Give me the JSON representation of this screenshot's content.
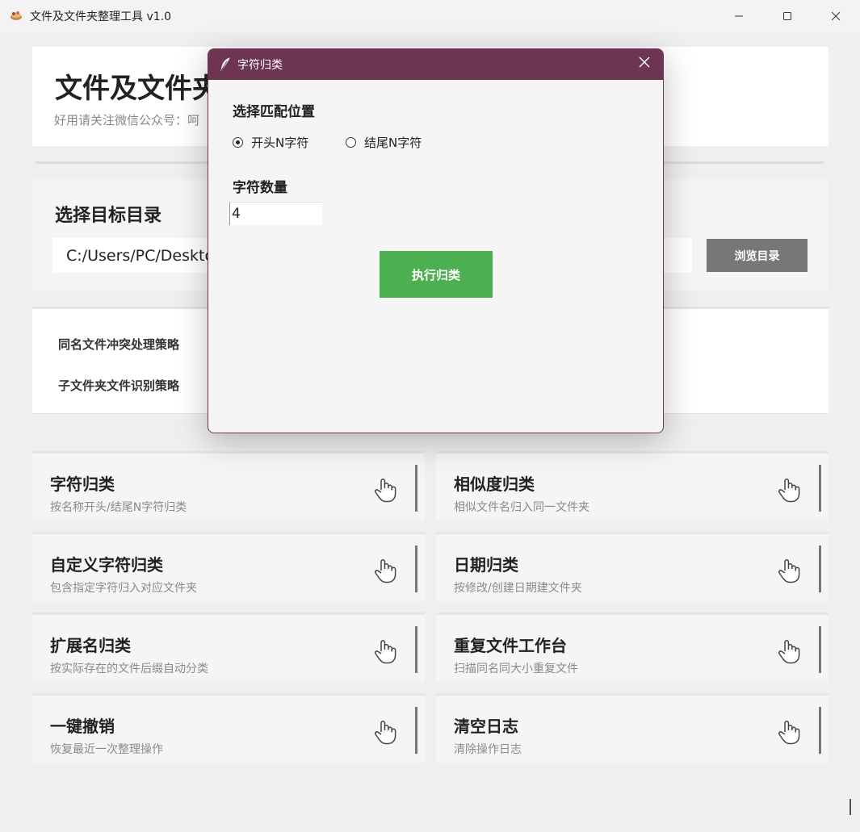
{
  "window": {
    "title": "文件及文件夹整理工具 v1.0",
    "minimize_icon": "minimize-icon",
    "maximize_icon": "maximize-icon",
    "close_icon": "close-icon"
  },
  "header": {
    "title": "文件及文件夹",
    "subtitle": "好用请关注微信公众号：呵"
  },
  "target_dir": {
    "heading": "选择目标目录",
    "path_value": "C:/Users/PC/Deskto",
    "browse_label": "浏览目录"
  },
  "strategies": {
    "conflict_label": "同名文件冲突处理策略",
    "subfolder_label": "子文件夹文件识别策略"
  },
  "features": [
    {
      "title": "字符归类",
      "desc": "按名称开头/结尾N字符归类",
      "icon": "hand-pointer-icon"
    },
    {
      "title": "相似度归类",
      "desc": "相似文件名归入同一文件夹",
      "icon": "hand-pointer-icon"
    },
    {
      "title": "自定义字符归类",
      "desc": "包含指定字符归入对应文件夹",
      "icon": "hand-pointer-icon"
    },
    {
      "title": "日期归类",
      "desc": "按修改/创建日期建文件夹",
      "icon": "hand-pointer-icon"
    },
    {
      "title": "扩展名归类",
      "desc": "按实际存在的文件后缀自动分类",
      "icon": "hand-pointer-icon"
    },
    {
      "title": "重复文件工作台",
      "desc": "扫描同名同大小重复文件",
      "icon": "hand-pointer-icon"
    },
    {
      "title": "一键撤销",
      "desc": "恢复最近一次整理操作",
      "icon": "hand-pointer-icon"
    },
    {
      "title": "清空日志",
      "desc": "清除操作日志",
      "icon": "hand-pointer-icon"
    }
  ],
  "dialog": {
    "title": "字符归类",
    "icon": "feather-icon",
    "match_position_heading": "选择匹配位置",
    "options": [
      {
        "label": "开头N字符",
        "checked": true
      },
      {
        "label": "结尾N字符",
        "checked": false
      }
    ],
    "count_heading": "字符数量",
    "count_value": "4",
    "execute_label": "执行归类"
  },
  "colors": {
    "dialog_titlebar": "#6e3553",
    "execute_button": "#4caf50",
    "browse_button": "#777777"
  }
}
